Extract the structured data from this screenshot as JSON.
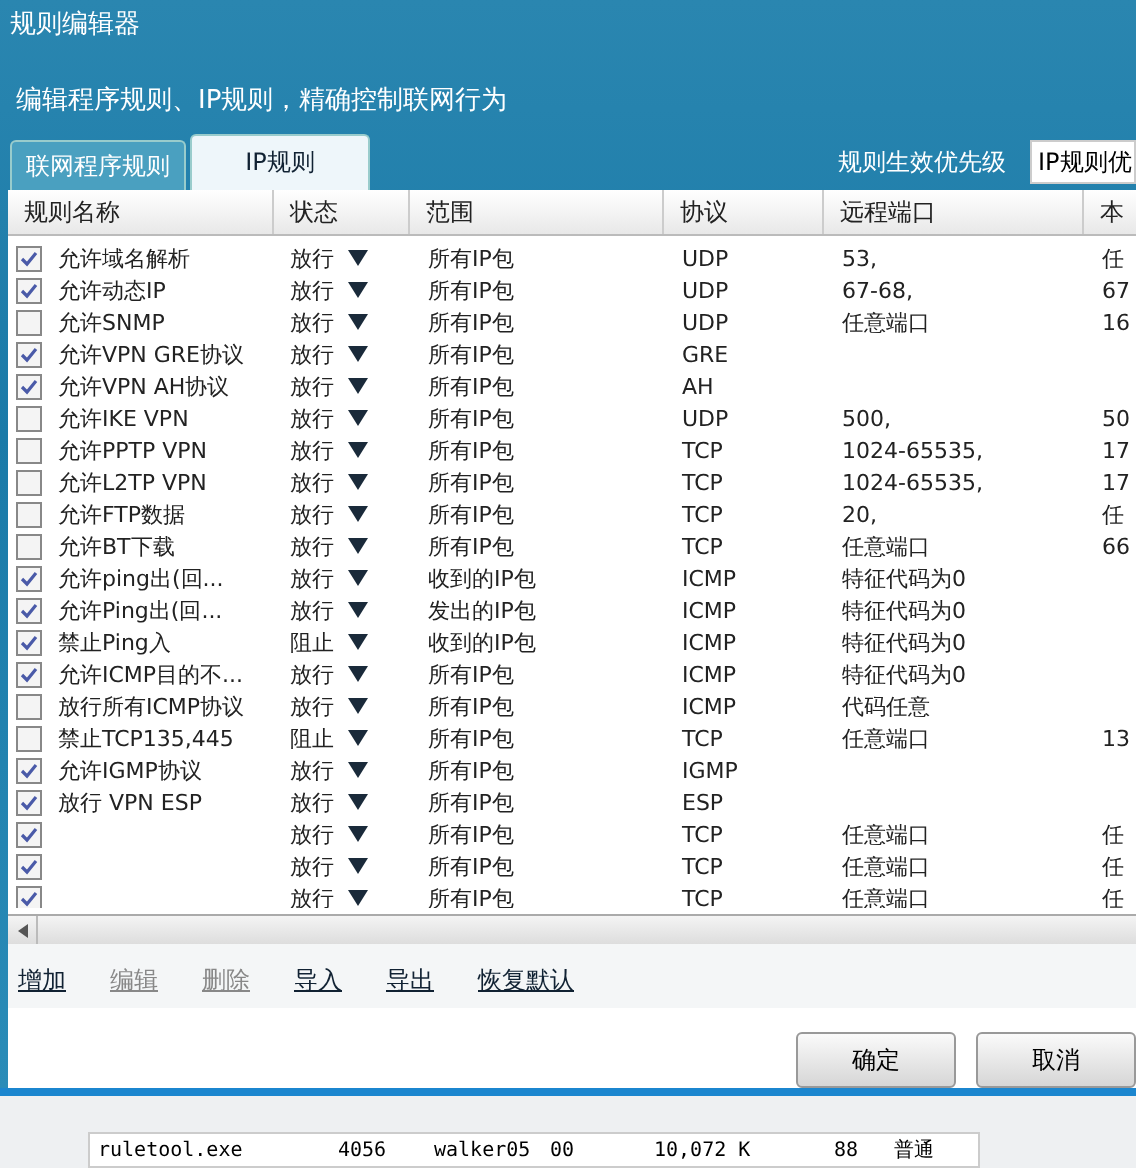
{
  "window": {
    "title": "规则编辑器"
  },
  "subtitle": "编辑程序规则、IP规则，精确控制联网行为",
  "tabs": [
    {
      "label": "联网程序规则",
      "selected": false
    },
    {
      "label": "IP规则",
      "selected": true
    }
  ],
  "priority": {
    "label": "规则生效优先级",
    "value": "IP规则优"
  },
  "table": {
    "columns": [
      "规则名称",
      "状态",
      "范围",
      "协议",
      "远程端口",
      "本"
    ],
    "rows": [
      {
        "checked": true,
        "name": "允许域名解析",
        "status": "放行",
        "scope": "所有IP包",
        "protocol": "UDP",
        "remote": "53,",
        "column_6": "任"
      },
      {
        "checked": true,
        "name": "允许动态IP",
        "status": "放行",
        "scope": "所有IP包",
        "protocol": "UDP",
        "remote": "67-68,",
        "column_6": "67"
      },
      {
        "checked": false,
        "name": "允许SNMP",
        "status": "放行",
        "scope": "所有IP包",
        "protocol": "UDP",
        "remote": "任意端口",
        "column_6": "16"
      },
      {
        "checked": true,
        "name": "允许VPN GRE协议",
        "status": "放行",
        "scope": "所有IP包",
        "protocol": "GRE"
      },
      {
        "checked": true,
        "name": "允许VPN AH协议",
        "status": "放行",
        "scope": "所有IP包",
        "protocol": "AH"
      },
      {
        "checked": false,
        "name": "允许IKE VPN",
        "status": "放行",
        "scope": "所有IP包",
        "protocol": "UDP",
        "remote": "500,",
        "column_6": "50"
      },
      {
        "checked": false,
        "name": "允许PPTP VPN",
        "status": "放行",
        "scope": "所有IP包",
        "protocol": "TCP",
        "remote": "1024-65535,",
        "column_6": "17"
      },
      {
        "checked": false,
        "name": "允许L2TP VPN",
        "status": "放行",
        "scope": "所有IP包",
        "protocol": "TCP",
        "remote": "1024-65535,",
        "column_6": "17"
      },
      {
        "checked": false,
        "name": "允许FTP数据",
        "status": "放行",
        "scope": "所有IP包",
        "protocol": "TCP",
        "remote": "20,",
        "column_6": "任"
      },
      {
        "checked": false,
        "name": "允许BT下载",
        "status": "放行",
        "scope": "所有IP包",
        "protocol": "TCP",
        "remote": "任意端口",
        "column_6": "66"
      },
      {
        "checked": true,
        "name": "允许ping出(回...",
        "status": "放行",
        "scope": "收到的IP包",
        "protocol": "ICMP",
        "remote": "特征代码为0"
      },
      {
        "checked": true,
        "name": "允许Ping出(回...",
        "status": "放行",
        "scope": "发出的IP包",
        "protocol": "ICMP",
        "remote": "特征代码为0"
      },
      {
        "checked": true,
        "name": "禁止Ping入",
        "status": "阻止",
        "scope": "收到的IP包",
        "protocol": "ICMP",
        "remote": "特征代码为0"
      },
      {
        "checked": true,
        "name": "允许ICMP目的不...",
        "status": "放行",
        "scope": "所有IP包",
        "protocol": "ICMP",
        "remote": "特征代码为0"
      },
      {
        "checked": false,
        "name": "放行所有ICMP协议",
        "status": "放行",
        "scope": "所有IP包",
        "protocol": "ICMP",
        "remote": "代码任意"
      },
      {
        "checked": false,
        "name": "禁止TCP135,445",
        "status": "阻止",
        "scope": "所有IP包",
        "protocol": "TCP",
        "remote": "任意端口",
        "column_6": "13"
      },
      {
        "checked": true,
        "name": "允许IGMP协议",
        "status": "放行",
        "scope": "所有IP包",
        "protocol": "IGMP"
      },
      {
        "checked": true,
        "name": "放行 VPN ESP",
        "status": "放行",
        "scope": "所有IP包",
        "protocol": "ESP"
      },
      {
        "checked": true,
        "status": "放行",
        "scope": "所有IP包",
        "protocol": "TCP",
        "remote": "任意端口",
        "column_6": "任"
      },
      {
        "checked": true,
        "status": "放行",
        "scope": "所有IP包",
        "protocol": "TCP",
        "remote": "任意端口",
        "column_6": "任"
      },
      {
        "checked": true,
        "status": "放行",
        "scope": "所有IP包",
        "protocol": "TCP",
        "remote": "任意端口",
        "column_6": "任"
      }
    ]
  },
  "actions": [
    {
      "label": "增加",
      "disabled": false
    },
    {
      "label": "编辑",
      "disabled": true
    },
    {
      "label": "删除",
      "disabled": true
    },
    {
      "label": "导入",
      "disabled": false
    },
    {
      "label": "导出",
      "disabled": false
    },
    {
      "label": "恢复默认",
      "disabled": false
    }
  ],
  "buttons": [
    "确定",
    "取消"
  ],
  "background_list": {
    "rows": [
      [
        "ruletool.exe",
        "4056",
        "walker05",
        "00",
        "10,072 K",
        "88",
        "普通"
      ]
    ]
  }
}
